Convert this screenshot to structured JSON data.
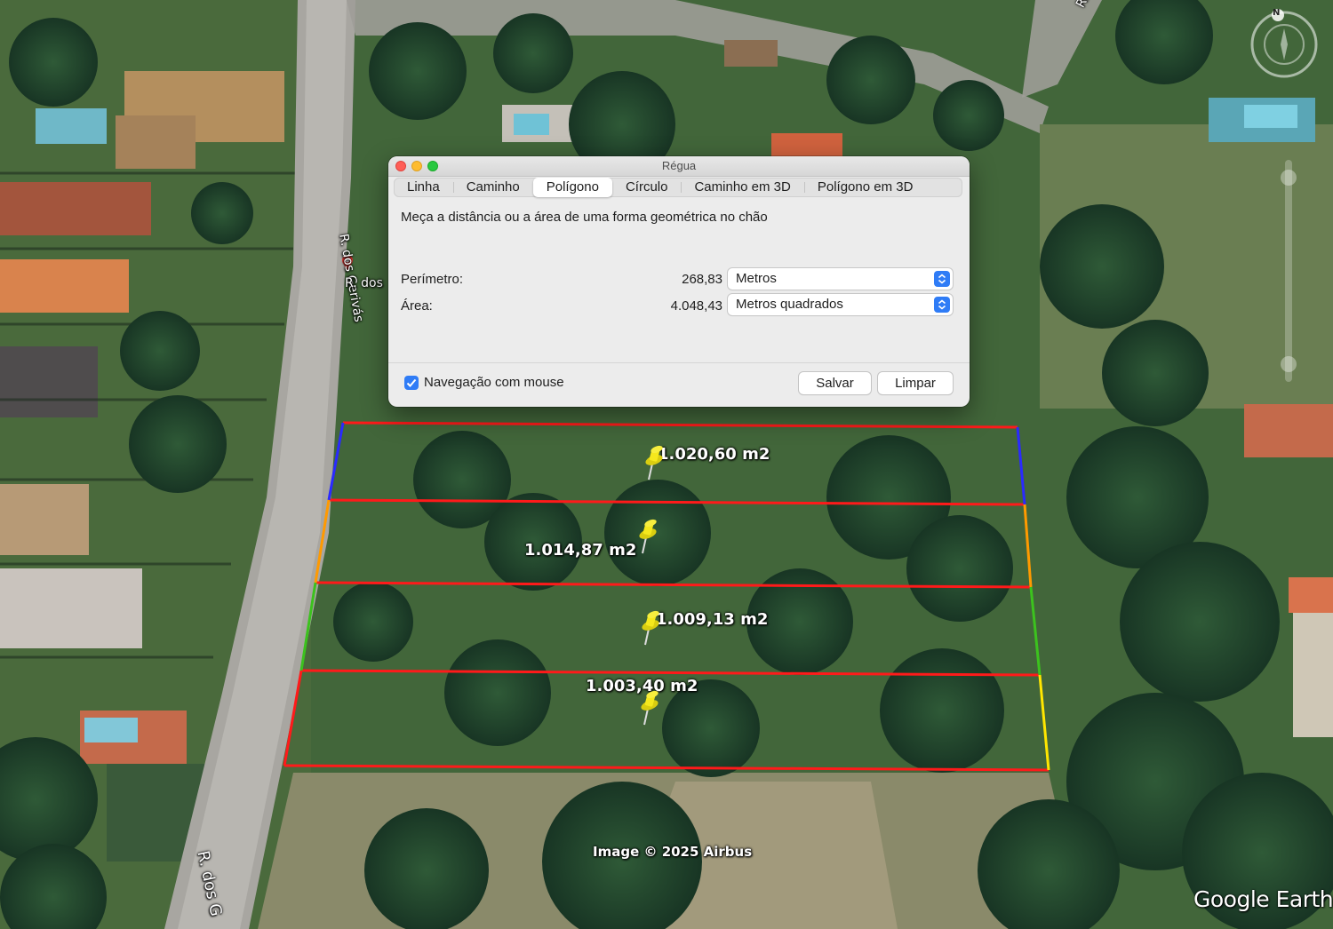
{
  "map": {
    "street_labels": {
      "top_right": "R. dos",
      "left_vertical": "R. dos Gerivás",
      "left_pin": "R. dos",
      "bottom_left": "R. dos G"
    },
    "area_labels": [
      "1.020,60 m2",
      "1.014,87 m2",
      "1.009,13 m2",
      "1.003,40 m2"
    ],
    "attribution": "Image © 2025 Airbus",
    "brand": "Google Earth",
    "compass_letter": "N",
    "icons": {
      "pin": "yellow-pushpin-icon",
      "compass": "compass-icon",
      "location": "location-marker-icon"
    },
    "colors": {
      "polygon_red": "#ff1a1a",
      "edge_blue": "#2a2aff",
      "edge_orange": "#ff9a00",
      "edge_green": "#3cc21e",
      "edge_yellow": "#ffe600",
      "pin_yellow": "#f5e81d"
    }
  },
  "dialog": {
    "title": "Régua",
    "tabs": [
      {
        "label": "Linha",
        "active": false
      },
      {
        "label": "Caminho",
        "active": false
      },
      {
        "label": "Polígono",
        "active": true
      },
      {
        "label": "Círculo",
        "active": false
      },
      {
        "label": "Caminho em 3D",
        "active": false
      },
      {
        "label": "Polígono em 3D",
        "active": false
      }
    ],
    "description": "Meça a distância ou a área de uma forma geométrica no chão",
    "perimeter": {
      "label": "Perímetro:",
      "value": "268,83",
      "unit": "Metros"
    },
    "area": {
      "label": "Área:",
      "value": "4.048,43",
      "unit": "Metros quadrados"
    },
    "mouse_nav": {
      "label": "Navegação com mouse",
      "checked": true
    },
    "save_label": "Salvar",
    "clear_label": "Limpar",
    "accent": "#2f7cf6"
  }
}
